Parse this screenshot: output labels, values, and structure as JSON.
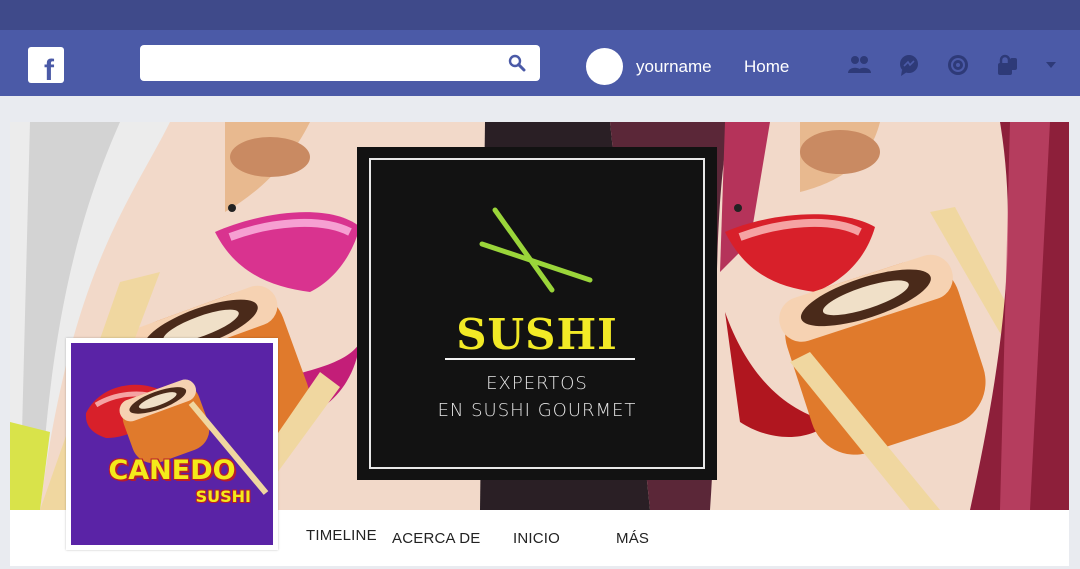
{
  "navbar": {
    "logo_letter": "f",
    "username": "yourname",
    "home_label": "Home",
    "icons": [
      "friends-icon",
      "messages-icon",
      "notifications-icon",
      "privacy-icon",
      "chevron-down-icon"
    ]
  },
  "cover": {
    "title": "SUSHI",
    "tagline_line1": "EXPERTOS",
    "tagline_line2": "EN SUSHI GOURMET"
  },
  "profile": {
    "brand_line1": "CANEDO",
    "brand_line2": "SUSHI"
  },
  "tabs": [
    {
      "label": "TIMELINE"
    },
    {
      "label": "ACERCA DE"
    },
    {
      "label": "INICIO"
    },
    {
      "label": "MÁS"
    }
  ],
  "colors": {
    "navbar": "#4b5aa7",
    "accent_yellow": "#f2ea26",
    "profile_purple": "#5a23a6"
  }
}
